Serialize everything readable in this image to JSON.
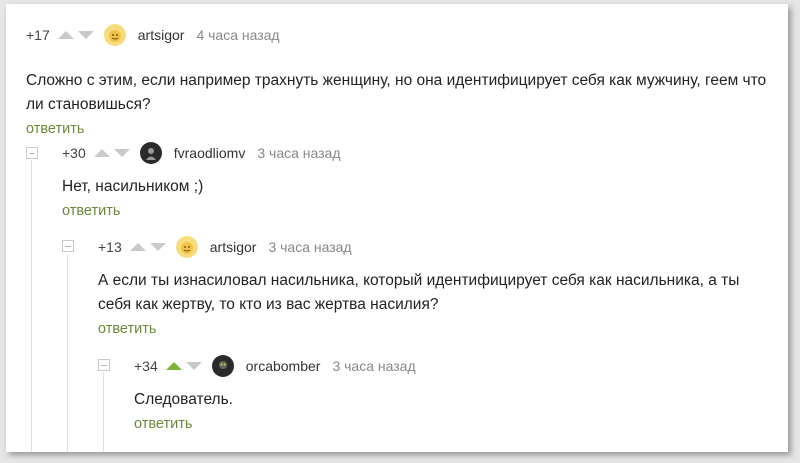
{
  "comments": [
    {
      "rating": "+17",
      "author": "artsigor",
      "time": "4 часа назад",
      "text": "Сложно с этим, если например трахнуть женщину, но она идентифицирует себя как мужчину, геем что ли становишься?",
      "reply": "ответить"
    },
    {
      "rating": "+30",
      "author": "fvraodliomv",
      "time": "3 часа назад",
      "text": "Нет, насильником ;)",
      "reply": "ответить"
    },
    {
      "rating": "+13",
      "author": "artsigor",
      "time": "3 часа назад",
      "text": "А если ты изнасиловал насильника, который идентифицирует себя как насильника, а ты себя как жертву, то кто из вас жертва насилия?",
      "reply": "ответить"
    },
    {
      "rating": "+34",
      "author": "orcabomber",
      "time": "3 часа назад",
      "text": "Следователь.",
      "reply": "ответить"
    }
  ],
  "colors": {
    "reply_link": "#6a8a3a",
    "upvote_active": "#7fb33a",
    "vote_inactive": "#c9c9c9"
  }
}
